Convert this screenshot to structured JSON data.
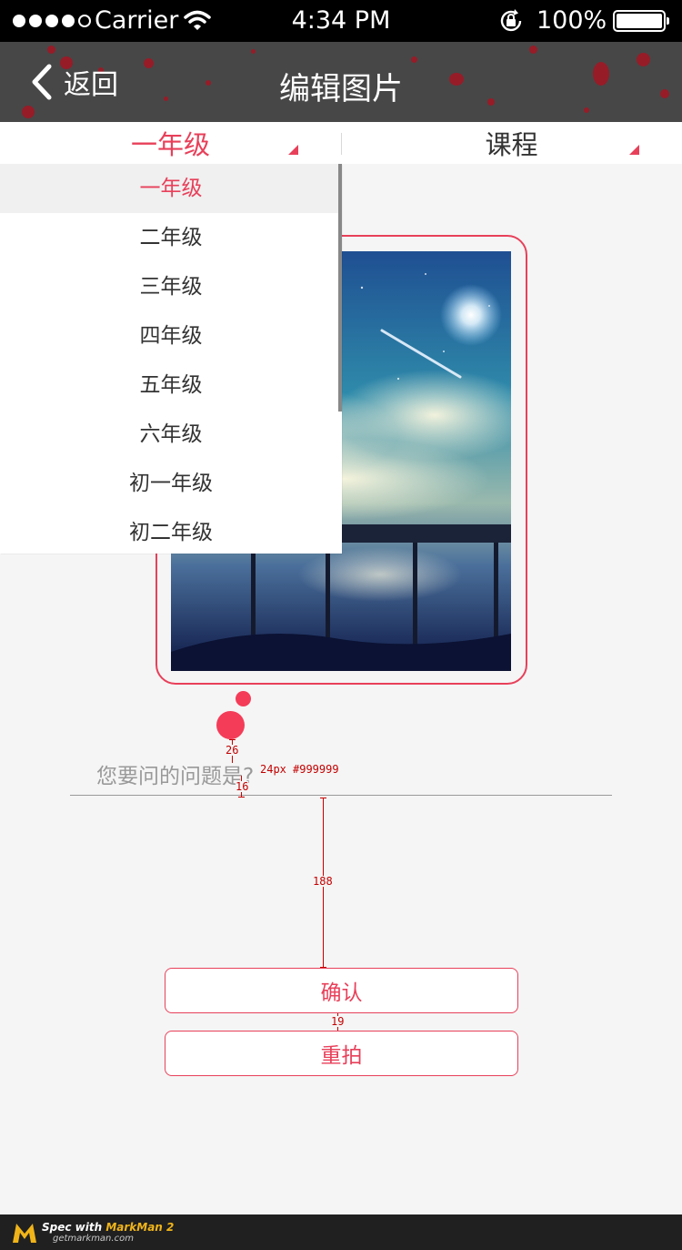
{
  "status_bar": {
    "carrier": "Carrier",
    "time": "4:34 PM",
    "battery_percent": "100%",
    "signal_icon": "signal-dots-icon",
    "wifi_icon": "wifi-icon",
    "lock_icon": "rotation-lock-icon",
    "battery_icon": "battery-icon"
  },
  "nav": {
    "back_label": "返回",
    "back_icon": "chevron-left-icon",
    "title": "编辑图片"
  },
  "filters": {
    "grade": "一年级",
    "course": "课程"
  },
  "dropdown": {
    "items": [
      "一年级",
      "二年级",
      "三年级",
      "四年级",
      "五年级",
      "六年级",
      "初一年级",
      "初二年级"
    ],
    "selected_index": 0
  },
  "question": {
    "placeholder": "您要问的问题是?"
  },
  "buttons": {
    "confirm": "确认",
    "retake": "重拍"
  },
  "spec": {
    "font_note": "24px",
    "color_note": "#999999",
    "gap_26": "26",
    "gap_16": "16",
    "gap_188": "188",
    "gap_19": "19"
  },
  "footer": {
    "brand_prefix": "Spec with ",
    "brand_name": "MarkMan 2",
    "url": "getmarkman.com"
  },
  "colors": {
    "accent": "#e8405a",
    "dot": "#f43c58",
    "nav_background": "#474747",
    "page_background": "#f5f5f5",
    "placeholder": "#999999"
  }
}
